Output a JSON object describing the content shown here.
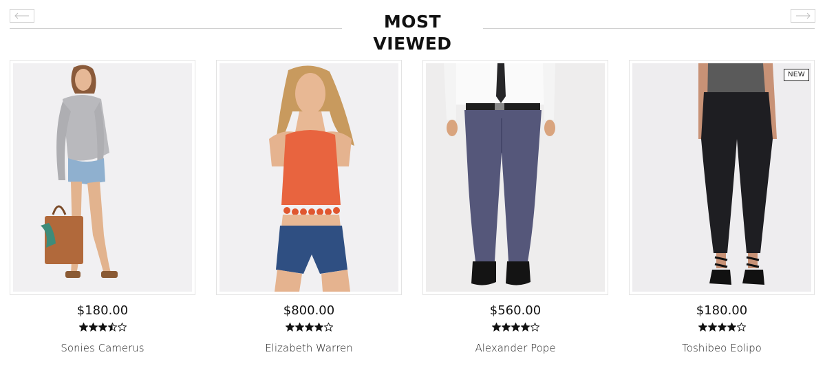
{
  "section": {
    "title": "MOST VIEWED",
    "prev_icon": "arrow-left-icon",
    "next_icon": "arrow-right-icon"
  },
  "colors": {
    "text": "#111111",
    "border": "#e3e3e3",
    "photo_bg": "#efeef0"
  },
  "products": [
    {
      "name": "Sonies Camerus",
      "price": "$180.00",
      "rating": 3.5,
      "max_rating": 5,
      "badge": "",
      "image": "woman-grey-sweatshirt-denim-shorts-tote-bag"
    },
    {
      "name": "Elizabeth Warren",
      "price": "$800.00",
      "rating": 4,
      "max_rating": 5,
      "badge": "",
      "image": "woman-orange-tassel-crop-top-denim-shorts"
    },
    {
      "name": "Alexander Pope",
      "price": "$560.00",
      "rating": 4,
      "max_rating": 5,
      "badge": "",
      "image": "man-grey-suit-trousers-black-shoes"
    },
    {
      "name": "Toshibeo Eolipo",
      "price": "$180.00",
      "rating": 4,
      "max_rating": 5,
      "badge": "NEW",
      "image": "woman-black-jeans-strappy-heels"
    }
  ]
}
